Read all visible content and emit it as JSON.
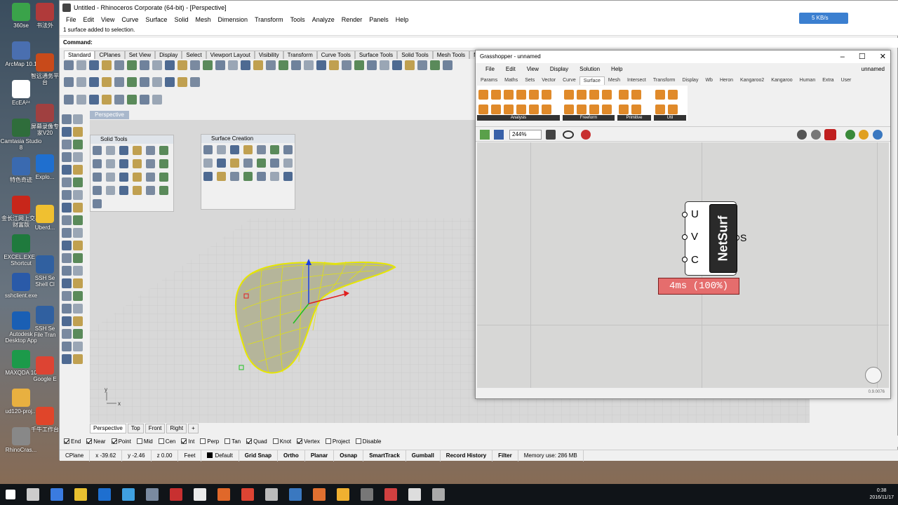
{
  "desktop": {
    "icons": [
      {
        "label": "360se",
        "color": "#3aa34a"
      },
      {
        "label": "ArcMap 10.1",
        "color": "#4a6fb0"
      },
      {
        "label": "EcEA²⁴",
        "color": "#ffffff"
      },
      {
        "label": "Camtasia Studio 8",
        "color": "#2f6d3b"
      },
      {
        "label": "特色奇迹",
        "color": "#3a6ab0"
      },
      {
        "label": "金长江网上交易财富版",
        "color": "#c8261a"
      },
      {
        "label": "EXCEL.EXE - Shortcut",
        "color": "#1f7a3d"
      },
      {
        "label": "sshclient.exe",
        "color": "#2a5aa8"
      },
      {
        "label": "Autodesk Desktop App",
        "color": "#1a5fb4"
      },
      {
        "label": "MAXQDA 10",
        "color": "#1c9a4a"
      },
      {
        "label": "ud120-proj...",
        "color": "#e8b040"
      },
      {
        "label": "RhinoCras...",
        "color": "#888888"
      }
    ],
    "icons2": [
      {
        "label": "书法外",
        "color": "#b03a3a"
      },
      {
        "label": "智远通务平台",
        "color": "#c84a1a"
      },
      {
        "label": "屏幕录像专家V20",
        "color": "#a04040"
      },
      {
        "label": "Explo...",
        "color": "#1f6fcf"
      },
      {
        "label": "Uberd...",
        "color": "#f0c030"
      },
      {
        "label": "SSH Se Shell Cl",
        "color": "#3060a0"
      },
      {
        "label": "SSH Se File Tran",
        "color": "#3060a0"
      },
      {
        "label": "Google E",
        "color": "#dd4433"
      },
      {
        "label": "千牛工作台",
        "color": "#e0452a"
      }
    ]
  },
  "rhino": {
    "title": "Untitled - Rhinoceros Corporate (64-bit) - [Perspective]",
    "menu": [
      "File",
      "Edit",
      "View",
      "Curve",
      "Surface",
      "Solid",
      "Mesh",
      "Dimension",
      "Transform",
      "Tools",
      "Analyze",
      "Render",
      "Panels",
      "Help"
    ],
    "cmd_history": "1 surface added to selection.",
    "cmd_prompt": "Command:",
    "tabs": [
      "Standard",
      "CPlanes",
      "Set View",
      "Display",
      "Select",
      "Viewport Layout",
      "Visibility",
      "Transform",
      "Curve Tools",
      "Surface Tools",
      "Solid Tools",
      "Mesh Tools",
      "New in V5"
    ],
    "viewport_label": "Perspective",
    "panel_solid": "Solid Tools",
    "panel_surface": "Surface Creation",
    "axis_x": "x",
    "axis_y": "y",
    "view_tabs": [
      "Perspective",
      "Top",
      "Front",
      "Right"
    ],
    "osnap": [
      {
        "label": "End",
        "on": true
      },
      {
        "label": "Near",
        "on": true
      },
      {
        "label": "Point",
        "on": true
      },
      {
        "label": "Mid",
        "on": false
      },
      {
        "label": "Cen",
        "on": false
      },
      {
        "label": "Int",
        "on": true
      },
      {
        "label": "Perp",
        "on": false
      },
      {
        "label": "Tan",
        "on": false
      },
      {
        "label": "Quad",
        "on": true
      },
      {
        "label": "Knot",
        "on": false
      },
      {
        "label": "Vertex",
        "on": true
      },
      {
        "label": "Project",
        "on": false
      },
      {
        "label": "Disable",
        "on": false
      }
    ],
    "status": {
      "cplane": "CPlane",
      "x": "x -39.62",
      "y": "y -2.46",
      "z": "z 0.00",
      "units": "Feet",
      "layer": "Default",
      "panes": [
        "Grid Snap",
        "Ortho",
        "Planar",
        "Osnap",
        "SmartTrack",
        "Gumball",
        "Record History",
        "Filter"
      ],
      "memory": "Memory use: 286 MB"
    }
  },
  "grasshopper": {
    "title": "Grasshopper - unnamed",
    "doc_name": "unnamed",
    "menu": [
      "File",
      "Edit",
      "View",
      "Display",
      "Solution",
      "Help"
    ],
    "tabs": [
      "Params",
      "Maths",
      "Sets",
      "Vector",
      "Curve",
      "Surface",
      "Mesh",
      "Intersect",
      "Transform",
      "Display",
      "Wb",
      "Heron",
      "Kangaroo2",
      "Kangaroo",
      "Human",
      "Extra",
      "User"
    ],
    "active_tab": "Surface",
    "groups": [
      "Analysis",
      "Freeform",
      "Primitive",
      "Util"
    ],
    "zoom": "244%",
    "component": {
      "name": "NetSurf",
      "inputs": [
        "U",
        "V",
        "C"
      ],
      "output": "S"
    },
    "profiler": "4ms (100%)",
    "version": "0.9.0076"
  },
  "net_speed": "5 KB/s",
  "clock": {
    "time": "0:38",
    "date": "2016/11/17"
  }
}
